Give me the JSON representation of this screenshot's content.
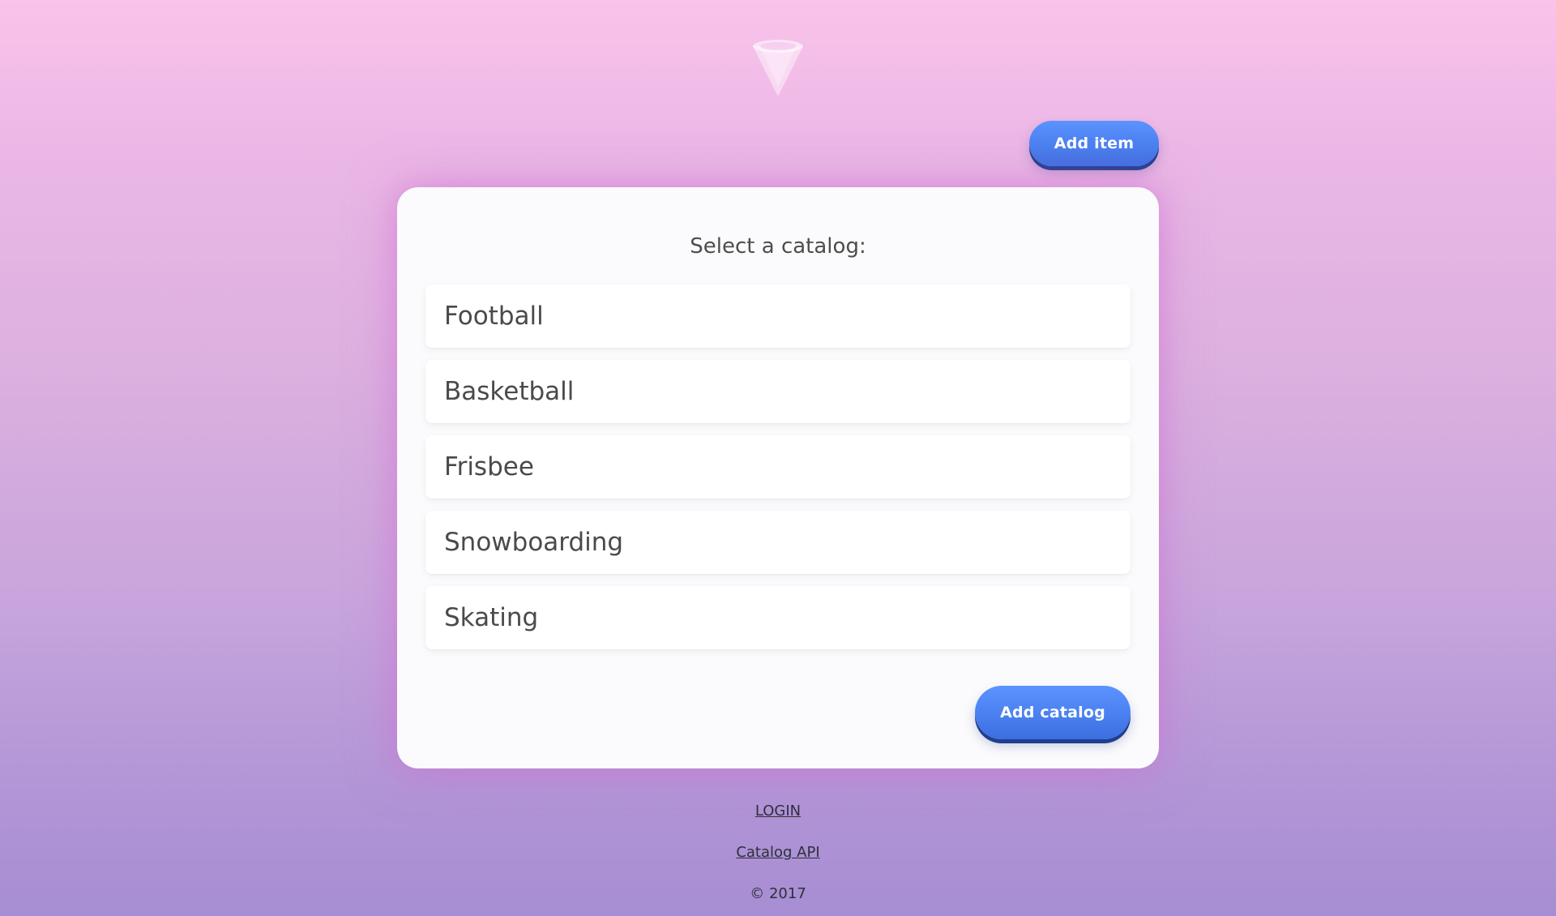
{
  "header": {
    "logo_icon": "cone-logo-icon",
    "add_item_label": "Add item"
  },
  "catalog_panel": {
    "title": "Select a catalog:",
    "items": [
      {
        "label": "Football"
      },
      {
        "label": "Basketball"
      },
      {
        "label": "Frisbee"
      },
      {
        "label": "Snowboarding"
      },
      {
        "label": "Skating"
      }
    ],
    "add_catalog_label": "Add catalog"
  },
  "footer": {
    "login_label": "LOGIN",
    "api_label": "Catalog API",
    "copyright": "© 2017"
  },
  "colors": {
    "button_blue": "#4a80f0",
    "button_shadow": "#1f3f8f",
    "background_top": "#f9c3ea",
    "background_bottom": "#a78dd3",
    "card_background": "#fbfbfd"
  }
}
